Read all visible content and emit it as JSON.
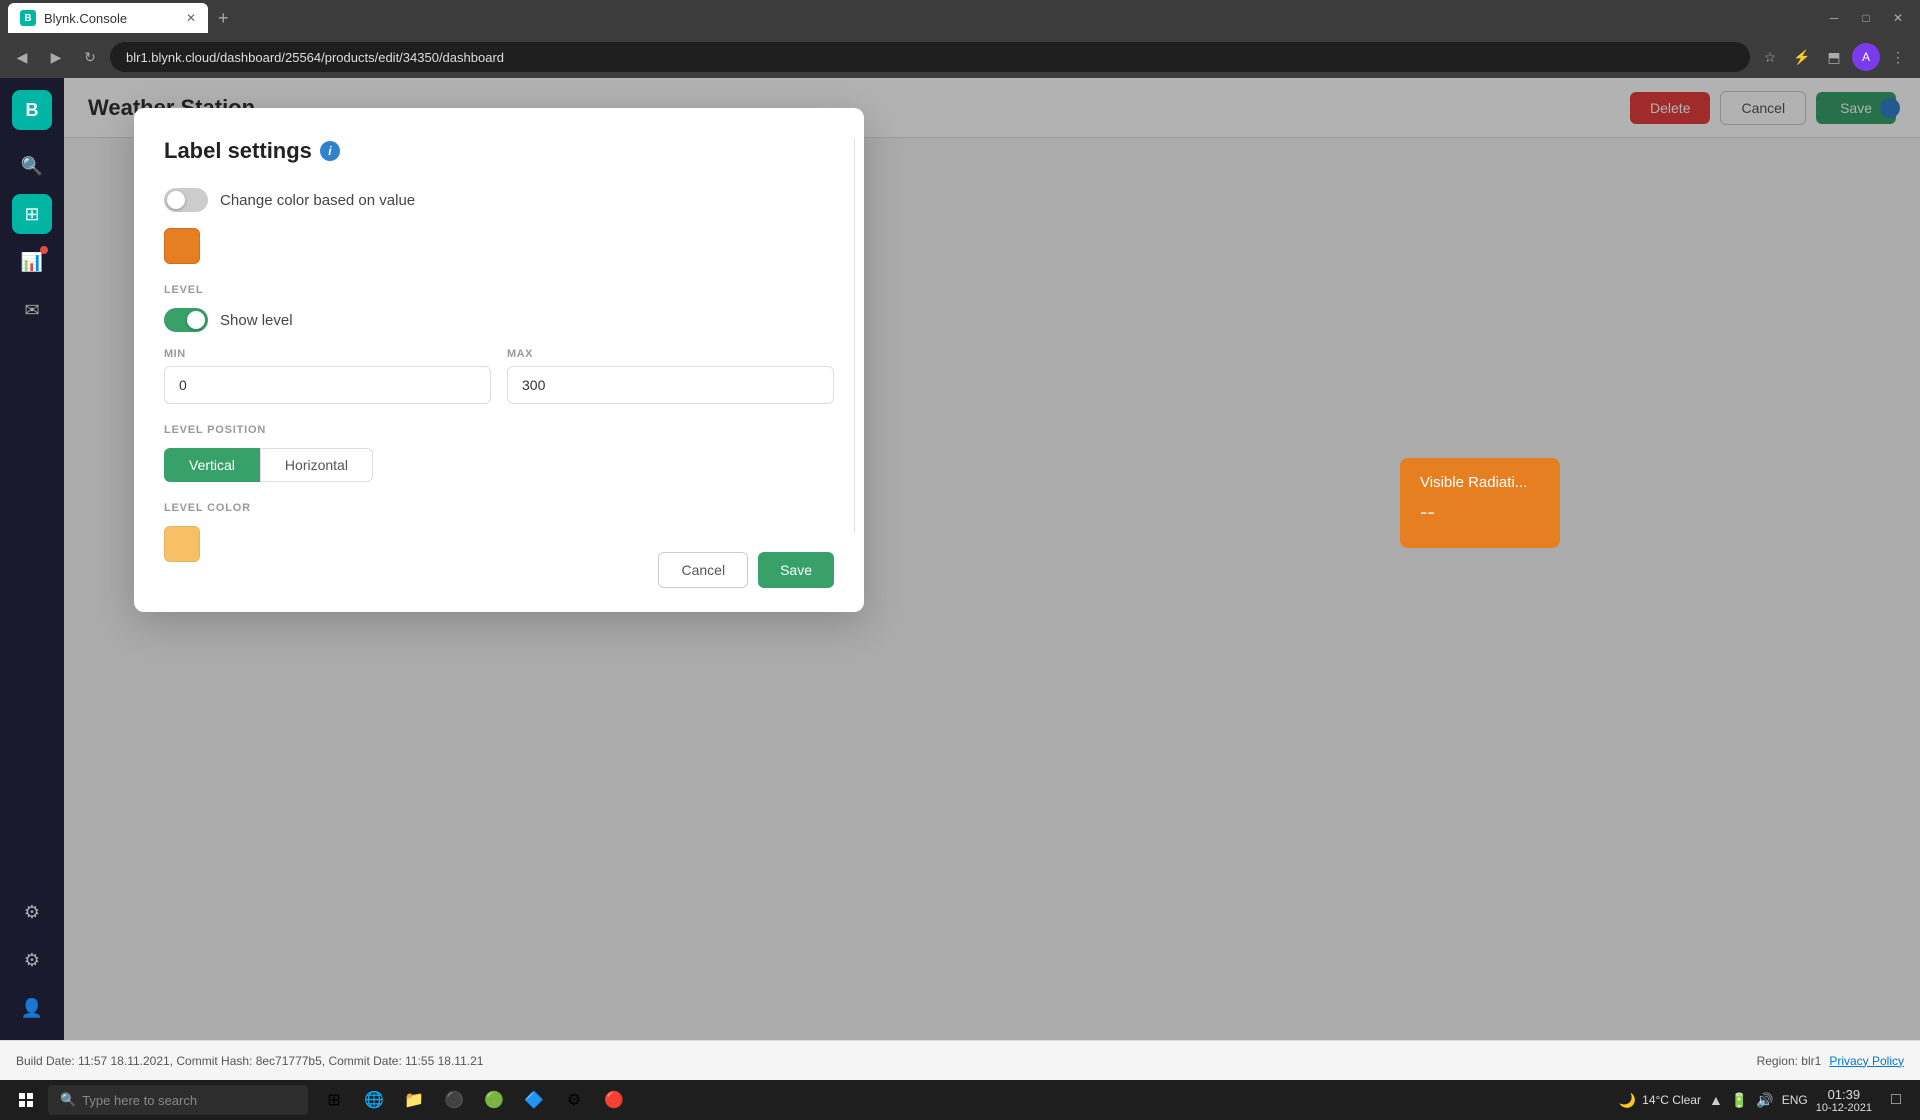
{
  "browser": {
    "tab_title": "Blynk.Console",
    "tab_favicon": "B",
    "address": "blr1.blynk.cloud/dashboard/25564/products/edit/34350/dashboard",
    "new_tab_symbol": "+",
    "window_controls": [
      "─",
      "□",
      "✕"
    ]
  },
  "app_header": {
    "title": "Weather Station",
    "btn_delete": "Delete",
    "btn_cancel": "Cancel",
    "btn_save": "Save"
  },
  "modal": {
    "title": "Label settings",
    "color_change_label": "Change color based on value",
    "level_section": "LEVEL",
    "show_level_label": "Show level",
    "min_label": "MIN",
    "max_label": "MAX",
    "min_value": "0",
    "max_value": "300",
    "level_position_label": "LEVEL POSITION",
    "position_vertical": "Vertical",
    "position_horizontal": "Horizontal",
    "level_color_label": "LEVEL COLOR",
    "btn_cancel": "Cancel",
    "btn_save": "Save"
  },
  "widget": {
    "title": "Visible Radiati...",
    "value": "--"
  },
  "status_bar": {
    "build_date": "Build Date: 11:57 18.11.2021",
    "commit_hash": "Commit Hash: 8ec71777b5",
    "commit_date": "Commit Date: 11:55 18.11.21",
    "region": "Region: blr1",
    "privacy": "Privacy Policy"
  },
  "taskbar": {
    "search_placeholder": "Type here to search",
    "time": "01:39",
    "date": "10-12-2021",
    "language": "ENG",
    "weather": "14°C  Clear"
  },
  "sidebar": {
    "logo": "B",
    "icons": [
      "🔍",
      "⊞",
      "📊",
      "✉",
      "⚙",
      "⚙",
      "👤"
    ]
  },
  "colors": {
    "orange_swatch": "#e67e22",
    "light_orange_swatch": "#f5c07a",
    "save_green": "#38a169",
    "delete_red": "#e53e3e"
  }
}
